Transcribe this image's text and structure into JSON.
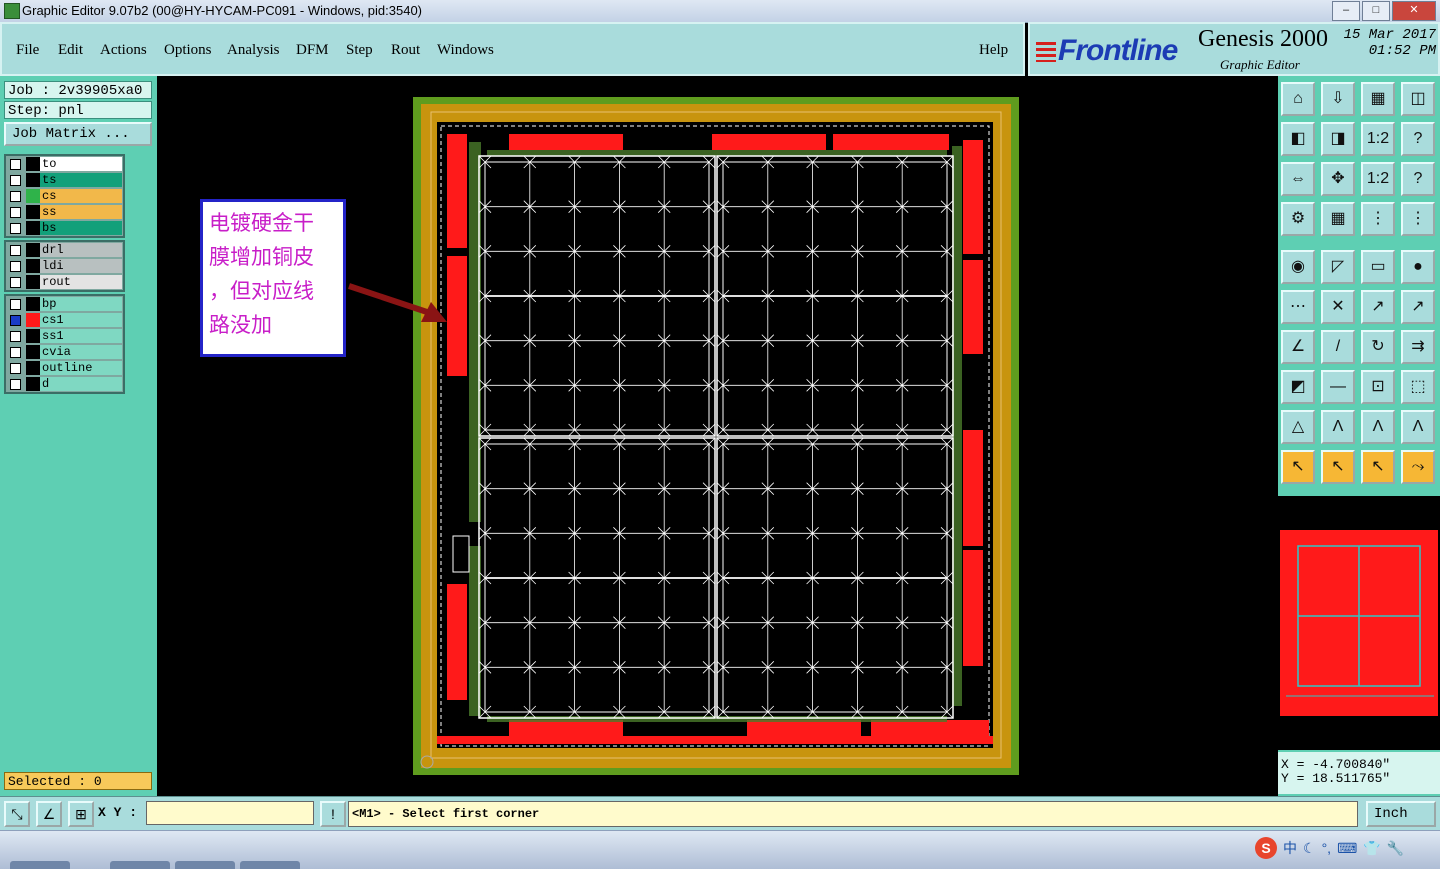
{
  "window": {
    "title": "Graphic Editor 9.07b2 (00@HY-HYCAM-PC091 - Windows, pid:3540)"
  },
  "menu": {
    "items": [
      "File",
      "Edit",
      "Actions",
      "Options",
      "Analysis",
      "DFM",
      "Step",
      "Rout",
      "Windows"
    ],
    "help": "Help"
  },
  "brand": {
    "logo": "Frontline",
    "product": "Genesis 2000",
    "module": "Graphic Editor",
    "date": "15 Mar 2017",
    "time": "01:52 PM"
  },
  "job": {
    "job_label": "Job : 2v39905xa0",
    "step_label": "Step: pnl",
    "matrix_button": "Job Matrix ..."
  },
  "layers": {
    "group1": [
      {
        "name": "to",
        "color": "#ffffff"
      },
      {
        "name": "ts",
        "color": "#12a07a"
      },
      {
        "name": "cs",
        "color": "#f2b84a",
        "swatch": "#2fb34a"
      },
      {
        "name": "ss",
        "color": "#f2b84a"
      },
      {
        "name": "bs",
        "color": "#12a07a"
      }
    ],
    "group2": [
      {
        "name": "drl",
        "color": "#b8c0c0"
      },
      {
        "name": "ldi",
        "color": "#b8c0c0"
      },
      {
        "name": "rout",
        "color": "#e3e3e3"
      }
    ],
    "group3": [
      {
        "name": "bp",
        "color": "#7fd8c2"
      },
      {
        "name": "cs1",
        "color": "#7fd8c2",
        "swatch": "#ff1a1a",
        "affected": true
      },
      {
        "name": "ss1",
        "color": "#7fd8c2"
      },
      {
        "name": "cvia",
        "color": "#7fd8c2"
      },
      {
        "name": "outline",
        "color": "#7fd8c2"
      },
      {
        "name": "d",
        "color": "#7fd8c2"
      }
    ]
  },
  "selected": "Selected : 0",
  "annotation": {
    "text_lines": [
      "电镀硬金干",
      "膜增加铜皮",
      "，但对应线",
      "路没加"
    ],
    "color": "#c81ec8"
  },
  "coords": {
    "x": "X = -4.700840\"",
    "y": "Y = 18.511765\""
  },
  "bottom": {
    "xy_label": "X Y :",
    "xy_value": "",
    "message": "<M1> - Select first corner",
    "units": "Inch"
  },
  "toolbar": {
    "icons": [
      "zoom-home-icon",
      "zoom-out-icon",
      "zoom-window-icon",
      "split-view-icon",
      "pan-left-icon",
      "pan-right-icon",
      "ratio-icon",
      "snap-icon",
      "fit-icon",
      "center-icon",
      "scale-icon",
      "help-icon",
      "measure-icon",
      "grid-icon",
      "layer-display-icon",
      "layer-display-icon",
      "pad-icon",
      "line-icon",
      "ruler-icon",
      "circle-icon",
      "node-icon",
      "cross-icon",
      "connect-icon",
      "move-icon",
      "slope-icon",
      "line-draw-icon",
      "rotate-icon",
      "flip-icon",
      "select-icon",
      "line-select-icon",
      "window-icon",
      "feature-icon",
      "edit-A-icon",
      "edit-A-icon",
      "edit-A-icon",
      "edit-A-icon",
      "arrow-icon",
      "arrow-box-icon",
      "arrow-circle-icon",
      "route-icon"
    ]
  },
  "ime": {
    "label": "中"
  }
}
